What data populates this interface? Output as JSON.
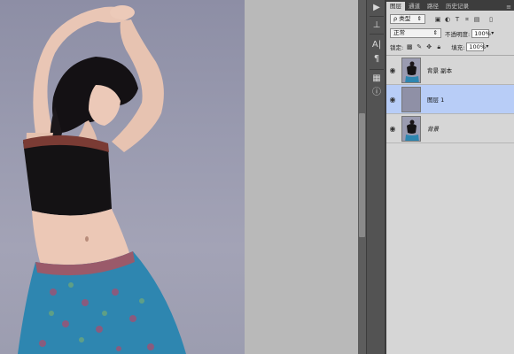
{
  "panel": {
    "tabs": [
      "图层",
      "通道",
      "路径",
      "历史记录"
    ],
    "active_tab": 0,
    "filter": {
      "label": "ρ 类型",
      "icons": [
        "image-filter-icon",
        "adjustment-filter-icon",
        "type-filter-icon",
        "shape-filter-icon",
        "smart-filter-icon"
      ]
    },
    "blend_mode": "正常",
    "opacity_label": "不透明度:",
    "opacity_value": "100%",
    "lock_label": "锁定:",
    "fill_label": "填充:",
    "fill_value": "100%",
    "layers": [
      {
        "name": "背景 副本",
        "visible": true,
        "selected": false,
        "italic": false,
        "thumb": "photo"
      },
      {
        "name": "图层 1",
        "visible": true,
        "selected": true,
        "italic": false,
        "thumb": "transparent"
      },
      {
        "name": "背景",
        "visible": true,
        "selected": false,
        "italic": true,
        "thumb": "photo"
      }
    ]
  },
  "colors": {
    "selected_layer": "#b8cdf7",
    "panel_bg": "#d6d6d6",
    "canvas_bg": "#b9b9b9",
    "dock_bg": "#535353",
    "top_bar": "#3d3d3d",
    "photo_bg": "#9a9bb0",
    "skirt": "#2e86b0"
  },
  "dock_icons": [
    "play-icon",
    "stamp-icon",
    "character-icon",
    "paragraph-icon",
    "brush-preset-icon",
    "info-icon"
  ]
}
